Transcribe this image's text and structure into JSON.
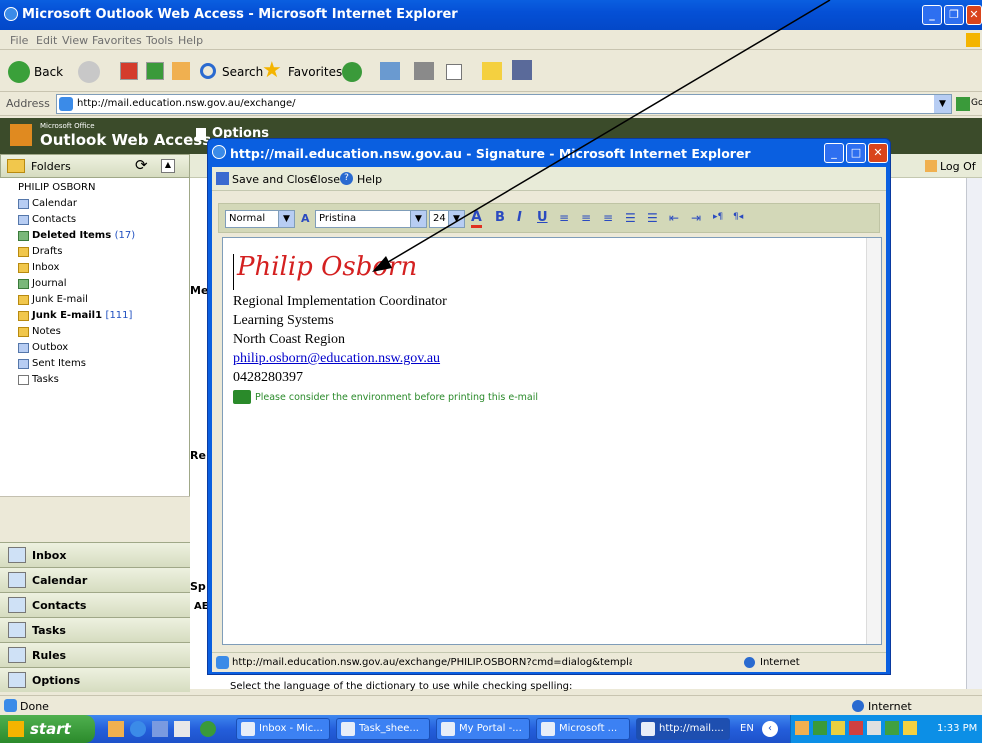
{
  "browser": {
    "title": "Microsoft Outlook Web Access - Microsoft Internet Explorer",
    "menu": [
      "File",
      "Edit",
      "View",
      "Favorites",
      "Tools",
      "Help"
    ],
    "toolbar": {
      "back": "Back",
      "search": "Search",
      "favorites": "Favorites"
    },
    "address_label": "Address",
    "url": "http://mail.education.nsw.gov.au/exchange/",
    "go": "Go",
    "status_left": "Done",
    "status_zone": "Internet"
  },
  "owa": {
    "brand_small": "Microsoft Office",
    "brand": "Outlook Web Access",
    "section": "Options",
    "logoff": "Log Of",
    "folders_label": "Folders",
    "tree": [
      {
        "label": "PHILIP OSBORN",
        "count": ""
      },
      {
        "label": "Calendar",
        "count": ""
      },
      {
        "label": "Contacts",
        "count": ""
      },
      {
        "label": "Deleted Items",
        "count": "(17)"
      },
      {
        "label": "Drafts",
        "count": ""
      },
      {
        "label": "Inbox",
        "count": ""
      },
      {
        "label": "Journal",
        "count": ""
      },
      {
        "label": "Junk E-mail",
        "count": ""
      },
      {
        "label": "Junk E-mail1",
        "count": "[111]"
      },
      {
        "label": "Notes",
        "count": ""
      },
      {
        "label": "Outbox",
        "count": ""
      },
      {
        "label": "Sent Items",
        "count": ""
      },
      {
        "label": "Tasks",
        "count": ""
      }
    ],
    "nav": [
      "Inbox",
      "Calendar",
      "Contacts",
      "Tasks",
      "Rules",
      "Options"
    ],
    "right_labels": {
      "me": "Me",
      "re": "Re",
      "sp": "Sp",
      "ab": "AE"
    },
    "spell_text": "Select the language of the dictionary to use while checking spelling:"
  },
  "dialog": {
    "title": "http://mail.education.nsw.gov.au - Signature - Microsoft Internet Explorer",
    "save_close": "Save and Close",
    "close": "Close",
    "help": "Help",
    "style_value": "Normal",
    "font_value": "Pristina",
    "size_value": "24",
    "status_url": "http://mail.education.nsw.gov.au/exchange/PHILIP.OSBORN?cmd=dialog&template=",
    "status_zone": "Internet"
  },
  "signature": {
    "name": "Philip Osborn",
    "lines": [
      "Regional Implementation Coordinator",
      "Learning Systems",
      "North Coast Region"
    ],
    "email": "philip.osborn@education.nsw.gov.au",
    "phone": "0428280397",
    "env_note": "Please consider the environment before printing this e-mail"
  },
  "taskbar": {
    "start": "start",
    "tasks": [
      "Inbox - Mic...",
      "Task_shee...",
      "My Portal -...",
      "Microsoft ...",
      "http://mail...."
    ],
    "lang": "EN",
    "time": "1:33 PM"
  },
  "colors": {
    "titlebar": "#0a5fe0",
    "signature_name": "#d42020",
    "env_note": "#2a8a2a"
  }
}
